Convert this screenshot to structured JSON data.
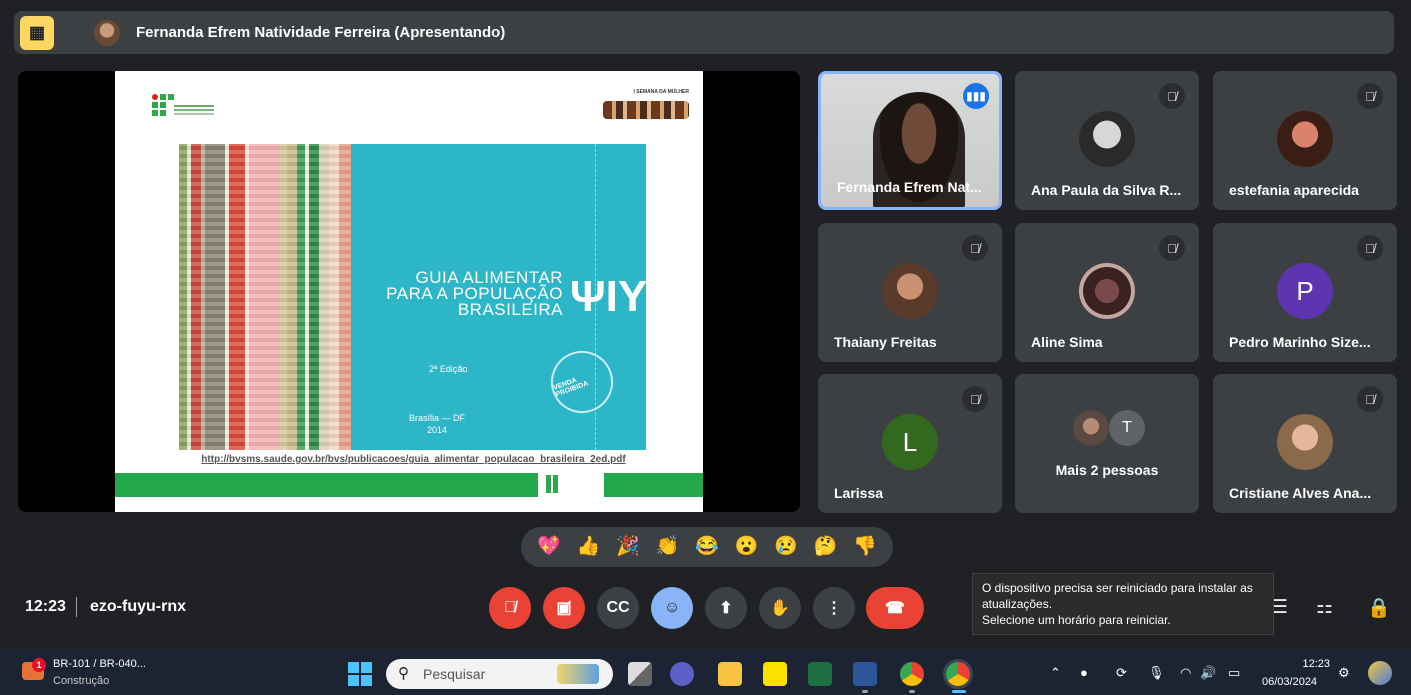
{
  "presenter": {
    "name": "Fernanda Efrem Natividade Ferreira (Apresentando)"
  },
  "slide": {
    "semana_label": "I SEMANA DA MULHER",
    "title_lines": [
      "GUIA ALIMENTAR",
      "PARA A POPULAÇÃO",
      "BRASILEIRA"
    ],
    "edition": "2ª Edição",
    "city": "Brasília — DF",
    "year": "2014",
    "stamp": "VENDA PROIBIDA",
    "url": "http://bvsms.saude.gov.br/bvs/publicacoes/guia_alimentar_populacao_brasileira_2ed.pdf"
  },
  "participants": [
    {
      "name": "Fernanda Efrem Nat...",
      "type": "video",
      "speaking": true
    },
    {
      "name": "Ana Paula da Silva R...",
      "type": "photo",
      "muted": true
    },
    {
      "name": "estefania aparecida",
      "type": "photo",
      "muted": true
    },
    {
      "name": "Thaiany Freitas",
      "type": "photo",
      "muted": true
    },
    {
      "name": "Aline Sima",
      "type": "photo",
      "muted": true
    },
    {
      "name": "Pedro Marinho Size...",
      "type": "letter",
      "letter": "P",
      "color": "#5e35b1",
      "muted": true
    },
    {
      "name": "Larissa",
      "type": "letter",
      "letter": "L",
      "color": "#33691e",
      "muted": true
    },
    {
      "name": "Cristiane Alves Ana...",
      "type": "photo",
      "muted": true
    }
  ],
  "more_people": {
    "label": "Mais 2 pessoas",
    "letter": "T"
  },
  "reactions": [
    "💖",
    "👍",
    "🎉",
    "👏",
    "😂",
    "😮",
    "😢",
    "🤔",
    "👎"
  ],
  "meeting": {
    "time": "12:23",
    "code": "ezo-fuyu-rnx"
  },
  "notification": {
    "line1": "O dispositivo precisa ser reiniciado para instalar as atualizações.",
    "line2": "Selecione um horário para reiniciar."
  },
  "taskbar": {
    "weather_title": "BR-101 / BR-040...",
    "weather_sub": "Construção",
    "weather_badge": "1",
    "search_placeholder": "Pesquisar",
    "time": "12:23",
    "date": "06/03/2024"
  },
  "colors": {
    "background": "#202124",
    "tile": "#3c4043",
    "end_call": "#ea4335",
    "accent": "#8ab4f8"
  }
}
